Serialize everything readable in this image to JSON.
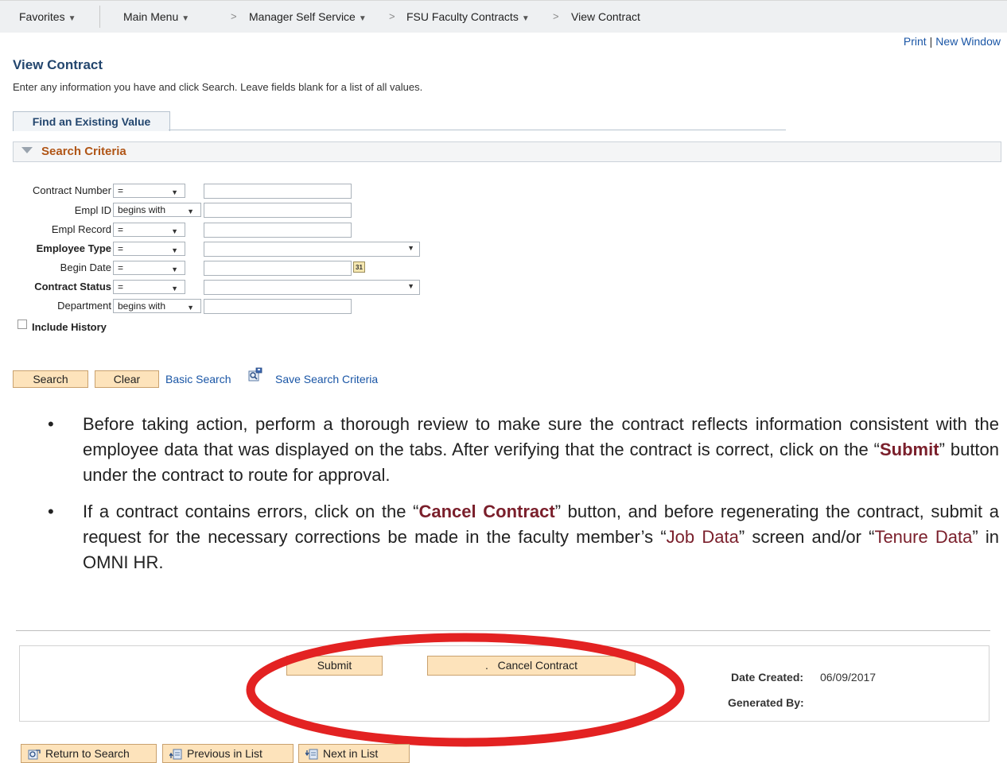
{
  "nav": {
    "favorites": "Favorites",
    "main_menu": "Main Menu",
    "manager_self_service": "Manager Self Service",
    "fsu_faculty_contracts": "FSU Faculty Contracts",
    "view_contract": "View Contract",
    "sep": ">"
  },
  "toplinks": {
    "print": "Print",
    "bar": "|",
    "new_window": "New Window"
  },
  "page": {
    "title": "View Contract",
    "instructions": "Enter any information you have and click Search. Leave fields blank for a list of all values."
  },
  "tab": {
    "label": "Find an Existing Value"
  },
  "search_criteria": {
    "title": "Search Criteria",
    "fields": {
      "contract_number": {
        "label": "Contract Number",
        "op": "="
      },
      "empl_id": {
        "label": "Empl ID",
        "op": "begins with"
      },
      "empl_record": {
        "label": "Empl Record",
        "op": "="
      },
      "employee_type": {
        "label": "Employee Type",
        "op": "="
      },
      "begin_date": {
        "label": "Begin Date",
        "op": "="
      },
      "contract_status": {
        "label": "Contract Status",
        "op": "="
      },
      "department": {
        "label": "Department",
        "op": "begins with"
      }
    },
    "include_history": "Include History",
    "calendar_icon_text": "31"
  },
  "actions": {
    "search": "Search",
    "clear": "Clear",
    "basic_search": "Basic Search",
    "save_search_criteria": "Save Search Criteria"
  },
  "bullets": {
    "b1": {
      "t1": "Before taking action, perform a thorough review to make sure the contract reflects information consistent with the employee data that was displayed on the tabs. After verifying that the contract is correct, click on the “",
      "em": "Submit",
      "t2": "” button under the contract to route for approval."
    },
    "b2": {
      "t1": "If a contract contains errors, click on the “",
      "em": "Cancel Contract",
      "t2": "” button, and before regenerating the contract, submit a request for the necessary corrections be made in the faculty member’s “",
      "hl1": "Job Data",
      "t3": "” screen and/or “",
      "hl2": "Tenure Data",
      "t4": "” in OMNI HR."
    }
  },
  "contract_panel": {
    "submit": "Submit",
    "cancel_contract": ".   Cancel Contract",
    "date_created_label": "Date Created:",
    "date_created_value": "06/09/2017",
    "generated_by_label": "Generated By:",
    "highlight_color": "#e32222"
  },
  "footer_nav": {
    "return_to_search": "Return to Search",
    "previous_in_list": "Previous in List",
    "next_in_list": "Next in List"
  }
}
